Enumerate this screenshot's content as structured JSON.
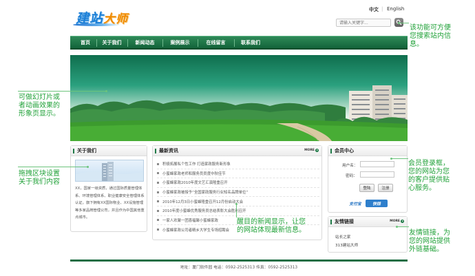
{
  "header": {
    "logo_main": "建站",
    "logo_accent": "大师",
    "lang_cn": "中文",
    "lang_sep": "|",
    "lang_en": "English",
    "search_placeholder": "请输入关键字...",
    "search_icon": "magnifier-icon"
  },
  "nav": {
    "items": [
      {
        "label": "首页"
      },
      {
        "label": "关于我们"
      },
      {
        "label": "新闻动态"
      },
      {
        "label": "案例展示"
      },
      {
        "label": "在线留言"
      },
      {
        "label": "联系我们"
      }
    ]
  },
  "about": {
    "title": "关于我们",
    "text": "XX，国家一级资质，通过国际质量管理体系、环境管理体系、职业健康安全管理体系认证。旗下拥有XX国际物业、XX设施管理等多家品牌管理公司，并且作为中国其他重点城市。"
  },
  "news": {
    "title": "最新资讯",
    "more": "MORE",
    "items": [
      {
        "title": "积极拓展私个性工作 打造家政服务新形象"
      },
      {
        "title": "小蜜蜂家政老师和服务员员度中秋佳节"
      },
      {
        "title": "小蜜蜂家政2010年度文艺汇演隆重召开"
      },
      {
        "title": "小蜜蜂家政被授予“全国家政服务行业知名品牌单位”"
      },
      {
        "title": "2010年12月3日小蜜蜂隆重召开12月份启动大会"
      },
      {
        "title": "2010年度小蜜蜂优秀服务员总结表彰大会胜利召开"
      },
      {
        "title": "一家人欢聚一团喜福聚小蜜蜂家政"
      },
      {
        "title": "小蜜蜂家政公司者精乡大学生专场招聘会"
      }
    ]
  },
  "member": {
    "title": "会员中心",
    "username_label": "用户名：",
    "password_label": "密码：",
    "login_label": "登陆",
    "register_label": "注册",
    "alipay_label": "支付宝",
    "quickpay_label": "快钱"
  },
  "links": {
    "title": "友情链接",
    "more": "MORE",
    "items": [
      {
        "label": "站长之家"
      },
      {
        "label": "313建站大师"
      }
    ]
  },
  "footer": {
    "text": "地址：厦门软件园   电话：0592-2525313   传真：0592-2525313"
  },
  "annotations": {
    "search": "该功能可方便\n您搜索站内信\n息。",
    "banner": "可做幻灯片或\n者动画效果的\n形象页显示。",
    "about": "拖拽区块设置\n关于我们内容",
    "member": "会员登录框，\n您的网站为您\n的客户提供贴\n心服务。",
    "news": "醒目的新闻显示，让您\n的网站体现最新信息。",
    "links": "友情链接，为\n您的网站提供\n外链基础。"
  },
  "colors": {
    "brand_green": "#1e7a47",
    "annotation_green": "#22a23a"
  }
}
